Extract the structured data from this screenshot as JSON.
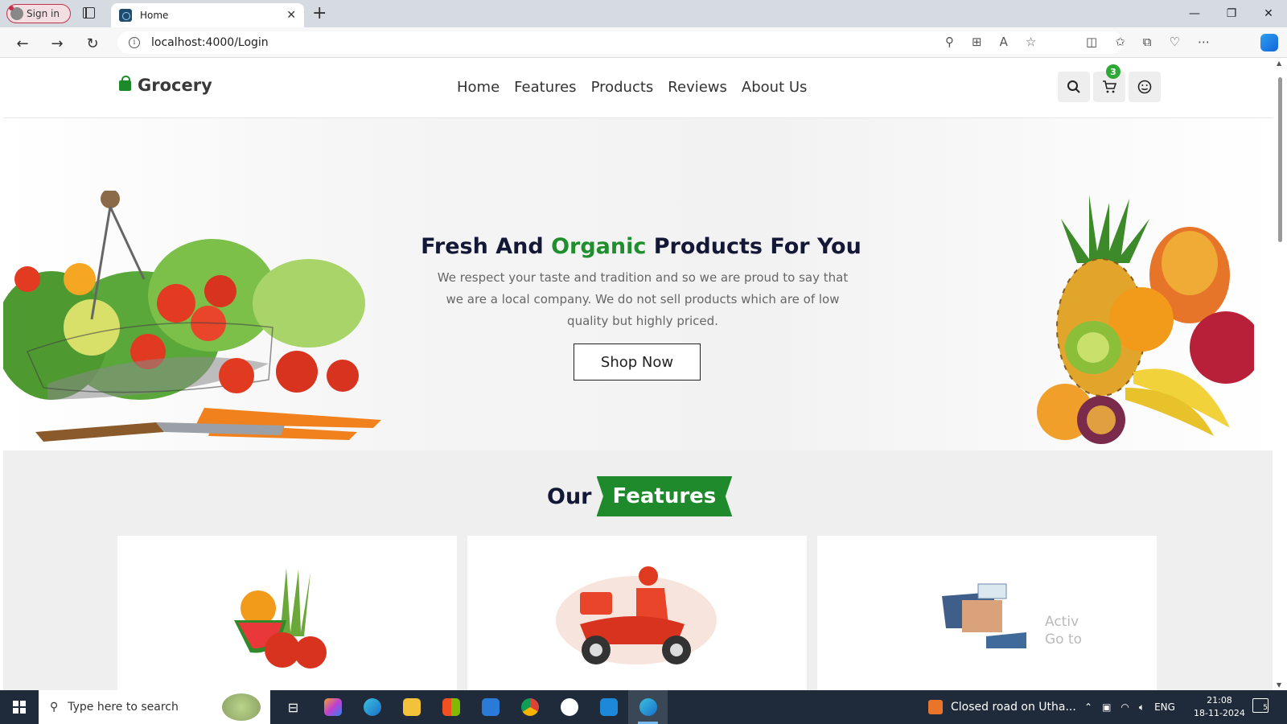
{
  "browser": {
    "signin_label": "Sign in",
    "tab_title": "Home",
    "tab_close": "✕",
    "new_tab": "+",
    "url": "localhost:4000/Login",
    "minimize": "—",
    "restore": "❐",
    "close": "✕"
  },
  "site": {
    "logo_text": "Grocery",
    "nav": [
      "Home",
      "Features",
      "Products",
      "Reviews",
      "About Us"
    ],
    "cart_count": "3"
  },
  "hero": {
    "title_part1": "Fresh And ",
    "title_highlight": "Organic",
    "title_part2": " Products For You",
    "description": "We respect your taste and tradition and so we are proud to say that we are a local company. We do not sell products which are of low quality but highly priced.",
    "button_label": "Shop Now"
  },
  "features": {
    "heading_prefix": "Our",
    "heading_tag": "Features"
  },
  "watermark": {
    "line1": "Activ",
    "line2": "Go to"
  },
  "taskbar": {
    "search_placeholder": "Type here to search",
    "news_text": "Closed road on Utha...",
    "language": "ENG",
    "time": "21:08",
    "date": "18-11-2024",
    "notification_count": "5"
  },
  "colors": {
    "brand_green": "#1e8a2b",
    "heading_navy": "#131836",
    "cart_badge": "#2ea836"
  }
}
